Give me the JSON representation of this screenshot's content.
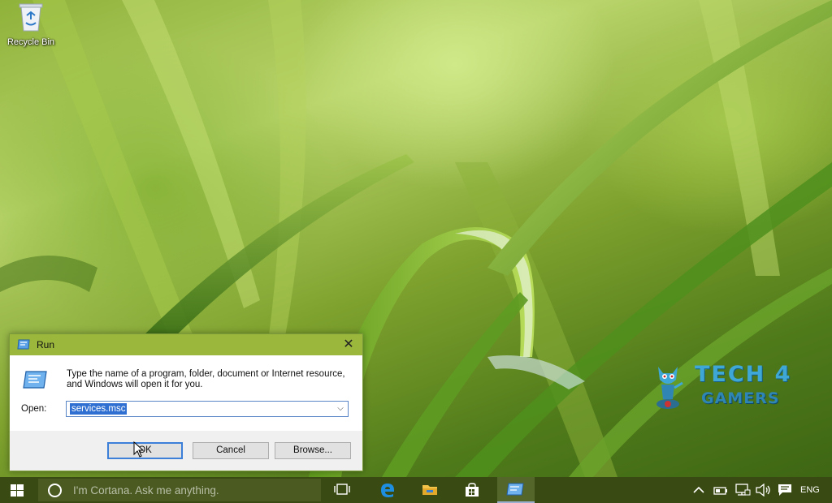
{
  "desktop": {
    "recycle_bin_label": "Recycle Bin"
  },
  "run_dialog": {
    "title": "Run",
    "description": "Type the name of a program, folder, document or Internet resource, and Windows will open it for you.",
    "open_label": "Open:",
    "open_value": "services.msc",
    "ok_label": "OK",
    "cancel_label": "Cancel",
    "browse_label": "Browse...",
    "close_glyph": "✕"
  },
  "watermark": {
    "line1": "TECH 4",
    "line2": "GAMERS"
  },
  "taskbar": {
    "search_placeholder": "I'm Cortana. Ask me anything.",
    "language": "ENG",
    "pinned": [
      "task-view-icon",
      "edge-icon",
      "file-explorer-icon",
      "store-icon",
      "run-icon"
    ],
    "tray_icons": [
      "chevron-up-icon",
      "battery-icon",
      "network-icon",
      "volume-icon",
      "action-center-icon"
    ]
  },
  "colors": {
    "titlebar": "#9bb83c",
    "taskbar": "#3a4a13",
    "selection": "#2f6fd1",
    "watermark": "#3fa7d6"
  }
}
